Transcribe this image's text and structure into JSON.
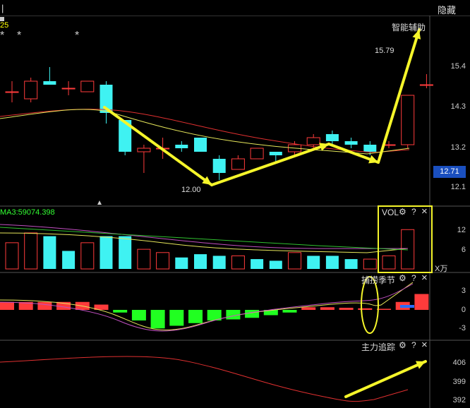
{
  "header": {
    "left_mark": "|",
    "hide_label": "隐藏"
  },
  "main_panel": {
    "ma_fragment": "25",
    "stars": [
      "*",
      "*",
      "*"
    ],
    "indicator_title": "智能辅助",
    "high_label": "15.79",
    "low_label": "12.00",
    "price_axis": [
      "15.4",
      "14.3",
      "13.2",
      "12.1"
    ],
    "current_price": "12.71"
  },
  "vol_panel": {
    "ma_label": "MA3:59074.398",
    "title": "VOL",
    "axis": [
      "12",
      "6"
    ],
    "unit": "X万"
  },
  "catch_panel": {
    "title": "捕捞季节",
    "axis": [
      "3",
      "0",
      "-3"
    ]
  },
  "track_panel": {
    "title": "主力追踪",
    "axis": [
      "406",
      "399",
      "392"
    ]
  },
  "controls": {
    "gear": "⚙",
    "help": "?",
    "close": "×"
  },
  "colors": {
    "up": "#ff3b3b",
    "down": "#3ff2f2",
    "arrow": "#f5f52a",
    "green": "#21ff21",
    "price_box": "#1a4fbf"
  },
  "chart_data": {
    "type": "candlestick",
    "candles": [
      {
        "o": 14.5,
        "c": 14.5,
        "h": 14.8,
        "l": 14.2
      },
      {
        "o": 14.3,
        "c": 14.8,
        "h": 14.9,
        "l": 14.2
      },
      {
        "o": 14.8,
        "c": 14.7,
        "h": 15.2,
        "l": 14.7
      },
      {
        "o": 14.6,
        "c": 14.6,
        "h": 14.8,
        "l": 14.4
      },
      {
        "o": 14.5,
        "c": 14.8,
        "h": 14.8,
        "l": 14.5
      },
      {
        "o": 14.7,
        "c": 13.9,
        "h": 14.8,
        "l": 13.6
      },
      {
        "o": 13.7,
        "c": 12.8,
        "h": 13.7,
        "l": 12.7
      },
      {
        "o": 12.8,
        "c": 12.9,
        "h": 13.0,
        "l": 12.2
      },
      {
        "o": 12.9,
        "c": 12.9,
        "h": 13.2,
        "l": 12.6
      },
      {
        "o": 13.0,
        "c": 12.9,
        "h": 13.1,
        "l": 12.8
      },
      {
        "o": 13.2,
        "c": 12.8,
        "h": 13.2,
        "l": 12.8
      },
      {
        "o": 12.6,
        "c": 12.2,
        "h": 12.7,
        "l": 12.0
      },
      {
        "o": 12.3,
        "c": 12.6,
        "h": 12.7,
        "l": 12.3
      },
      {
        "o": 12.6,
        "c": 12.9,
        "h": 12.9,
        "l": 12.6
      },
      {
        "o": 12.8,
        "c": 12.7,
        "h": 12.8,
        "l": 12.5
      },
      {
        "o": 12.8,
        "c": 13.0,
        "h": 13.1,
        "l": 12.7
      },
      {
        "o": 13.0,
        "c": 13.2,
        "h": 13.3,
        "l": 12.9
      },
      {
        "o": 13.3,
        "c": 13.1,
        "h": 13.4,
        "l": 13.0
      },
      {
        "o": 13.1,
        "c": 13.0,
        "h": 13.2,
        "l": 12.9
      },
      {
        "o": 13.0,
        "c": 12.8,
        "h": 13.1,
        "l": 12.7
      },
      {
        "o": 13.0,
        "c": 13.0,
        "h": 13.1,
        "l": 12.9
      },
      {
        "o": 13.0,
        "c": 14.4,
        "h": 14.4,
        "l": 12.9
      },
      {
        "o": 14.7,
        "c": 14.7,
        "h": 15.0,
        "l": 14.6
      }
    ],
    "volume": [
      {
        "v": 8,
        "up": true
      },
      {
        "v": 11,
        "up": true
      },
      {
        "v": 10,
        "up": false
      },
      {
        "v": 5.5,
        "up": false
      },
      {
        "v": 8,
        "up": true
      },
      {
        "v": 10,
        "up": false
      },
      {
        "v": 10,
        "up": false
      },
      {
        "v": 6,
        "up": true
      },
      {
        "v": 5,
        "up": true
      },
      {
        "v": 3.5,
        "up": false
      },
      {
        "v": 4.5,
        "up": false
      },
      {
        "v": 4,
        "up": false
      },
      {
        "v": 4,
        "up": true
      },
      {
        "v": 3,
        "up": false
      },
      {
        "v": 2.5,
        "up": false
      },
      {
        "v": 5,
        "up": true
      },
      {
        "v": 4,
        "up": false
      },
      {
        "v": 4,
        "up": false
      },
      {
        "v": 3,
        "up": false
      },
      {
        "v": 3,
        "up": true
      },
      {
        "v": 4,
        "up": true
      },
      {
        "v": 12,
        "up": true
      }
    ],
    "vol_ylim": [
      0,
      14
    ],
    "catch_bars": [
      1.5,
      1.5,
      1.5,
      1.5,
      1.5,
      1.0,
      -0.5,
      -2.0,
      -3.5,
      -3.0,
      -2.5,
      -2.0,
      -1.8,
      -1.5,
      -1.0,
      -0.5,
      0.5,
      0.5,
      0.4,
      0.3,
      0.2,
      1.5,
      3.0
    ],
    "catch_ylim": [
      -4,
      4
    ],
    "price_ylim": [
      11.8,
      16.0
    ],
    "track_ylim": [
      390,
      410
    ]
  }
}
